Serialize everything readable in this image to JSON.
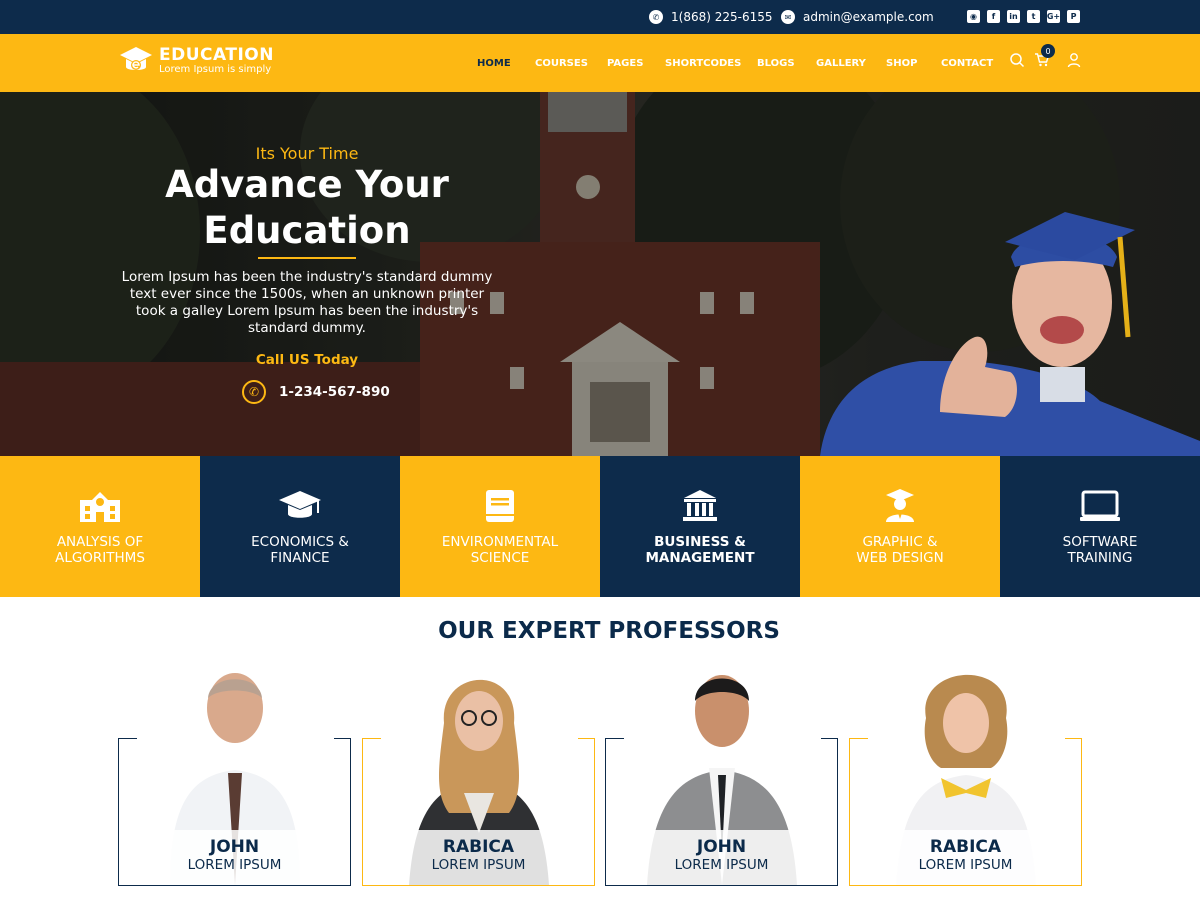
{
  "topbar": {
    "phone": "1(868) 225-6155",
    "email": "admin@example.com",
    "social_icons": [
      "instagram-icon",
      "facebook-icon",
      "linkedin-icon",
      "twitter-icon",
      "google-plus-icon",
      "pinterest-icon"
    ]
  },
  "brand": {
    "title": "EDUCATION",
    "subtitle": "Lorem Ipsum is simply"
  },
  "nav": {
    "items": [
      {
        "label": "HOME",
        "active": true
      },
      {
        "label": "COURSES"
      },
      {
        "label": "PAGES"
      },
      {
        "label": "SHORTCODES"
      },
      {
        "label": "BLOGS"
      },
      {
        "label": "GALLERY"
      },
      {
        "label": "SHOP"
      },
      {
        "label": "CONTACT"
      }
    ],
    "cart_count": "0"
  },
  "hero": {
    "kicker": "Its Your Time",
    "title_line1": "Advance Your",
    "title_line2": "Education",
    "description": "Lorem Ipsum has been the industry's standard dummy text ever since the 1500s, when an unknown printer took a galley Lorem Ipsum has been the industry's standard dummy.",
    "call_label": "Call US Today",
    "phone": "1-234-567-890"
  },
  "categories": [
    {
      "line1": "ANALYSIS OF",
      "line2": "ALGORITHMS",
      "icon": "school-building-icon",
      "color": "#fdb813"
    },
    {
      "line1": "ECONOMICS &",
      "line2": "FINANCE",
      "icon": "graduation-cap-icon",
      "color": "#0d2b4b"
    },
    {
      "line1": "ENVIRONMENTAL",
      "line2": "SCIENCE",
      "icon": "book-icon",
      "color": "#fdb813"
    },
    {
      "line1": "BUSINESS &",
      "line2": "MANAGEMENT",
      "icon": "bank-icon",
      "color": "#0d2b4b"
    },
    {
      "line1": "GRAPHIC &",
      "line2": "WEB DESIGN",
      "icon": "graduate-person-icon",
      "color": "#fdb813"
    },
    {
      "line1": "SOFTWARE",
      "line2": "TRAINING",
      "icon": "laptop-icon",
      "color": "#0d2b4b"
    }
  ],
  "professors_section": {
    "title": "OUR EXPERT PROFESSORS",
    "professors": [
      {
        "name": "JOHN",
        "role": "LOREM IPSUM"
      },
      {
        "name": "RABICA",
        "role": "LOREM IPSUM"
      },
      {
        "name": "JOHN",
        "role": "LOREM IPSUM"
      },
      {
        "name": "RABICA",
        "role": "LOREM IPSUM"
      }
    ]
  },
  "colors": {
    "accent": "#fdb813",
    "navy": "#0d2b4b"
  }
}
